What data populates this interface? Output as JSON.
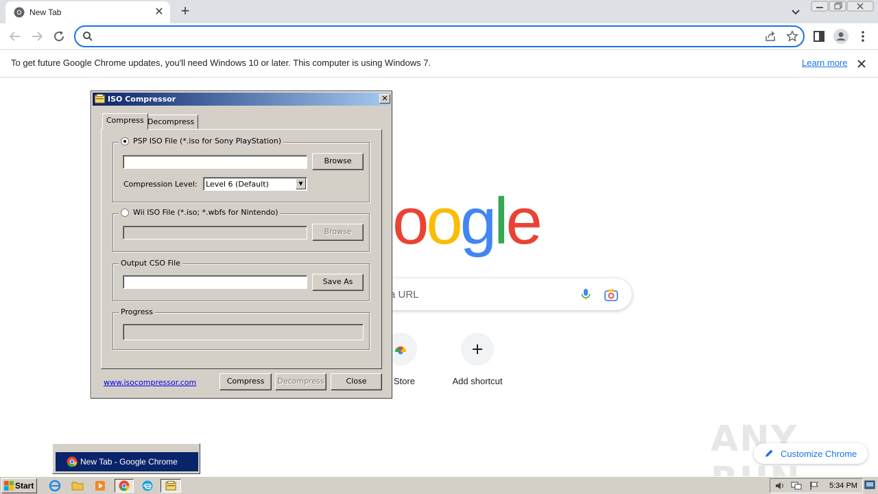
{
  "browser": {
    "tab_title": "New Tab",
    "omnibox_value": "",
    "infobar_text": "To get future Google Chrome updates, you'll need Windows 10 or later. This computer is using Windows 7.",
    "infobar_link": "Learn more"
  },
  "ntp": {
    "logo_letters": [
      "o",
      "o",
      "g",
      "l",
      "e"
    ],
    "logo_colors": [
      "#ea4335",
      "#fbbc05",
      "#4285f4",
      "#34a853",
      "#ea4335"
    ],
    "search_placeholder_partial": "a URL",
    "shortcuts": [
      {
        "label": "b Store"
      },
      {
        "label": "Add shortcut"
      }
    ],
    "customize_label": "Customize Chrome",
    "watermark": "ANY RUN"
  },
  "iso_window": {
    "title": "ISO Compressor",
    "tabs": [
      "Compress",
      "Decompress"
    ],
    "active_tab": "Compress",
    "psp_radio_label": "PSP ISO File (*.iso for Sony PlayStation)",
    "psp_selected": true,
    "psp_path": "",
    "browse_label": "Browse",
    "compression_level_label": "Compression Level:",
    "compression_level_value": "Level 6 (Default)",
    "wii_radio_label": "Wii ISO File (*.iso; *.wbfs for Nintendo)",
    "wii_path": "",
    "output_group_label": "Output CSO File",
    "output_path": "",
    "save_as_label": "Save As",
    "progress_group_label": "Progress",
    "progress_value": 0,
    "website_link": "www.isocompressor.com",
    "compress_label": "Compress",
    "decompress_label": "Decompress",
    "close_label": "Close"
  },
  "taskbar": {
    "start_label": "Start",
    "popup_item_label": "New Tab - Google Chrome",
    "clock": "5:34 PM"
  },
  "colors": {
    "accent": "#1a73e8",
    "title_bar_start": "#0a246a",
    "title_bar_end": "#a6caf0",
    "win_face": "#d4d0c8"
  }
}
